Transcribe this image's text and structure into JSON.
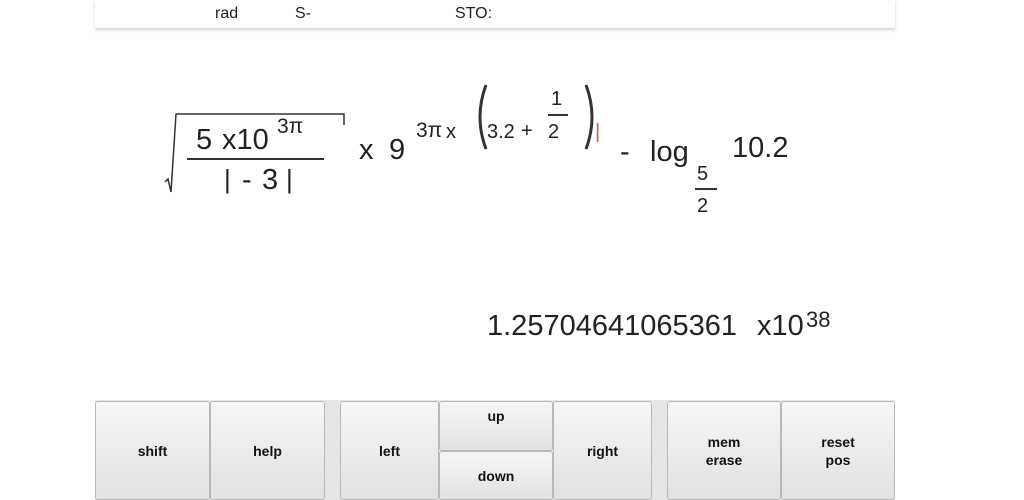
{
  "status": {
    "angle_mode": "rad",
    "s_indicator": "S-",
    "sto_indicator": "STO:"
  },
  "expression": {
    "frac_num_5": "5",
    "frac_num_x10": "x10",
    "frac_num_exp": "3π",
    "frac_den_abs_open": "|",
    "frac_den_minus": "-",
    "frac_den_3": "3",
    "frac_den_abs_close": "|",
    "times": "x",
    "base_9": "9",
    "pow_3pi": "3π",
    "pow_x": "x",
    "paren_open": "(",
    "inner_3_2": "3.2",
    "inner_plus": "+",
    "inner_half_num": "1",
    "inner_half_den": "2",
    "paren_close": ")",
    "cursor": "|",
    "minus": "-",
    "log_label": "log",
    "log_base_num": "5",
    "log_base_den": "2",
    "log_arg": "10.2"
  },
  "result": {
    "mantissa": "1.25704641065361",
    "times_ten": "x10",
    "exponent": "38"
  },
  "keys": {
    "shift": "shift",
    "help": "help",
    "left": "left",
    "up": "up",
    "down": "down",
    "right": "right",
    "mem_line1": "mem",
    "mem_line2": "erase",
    "reset_line1": "reset",
    "reset_line2": "pos"
  },
  "colors": {
    "cursor": "#e05050",
    "key_border": "#b8b8b8"
  }
}
